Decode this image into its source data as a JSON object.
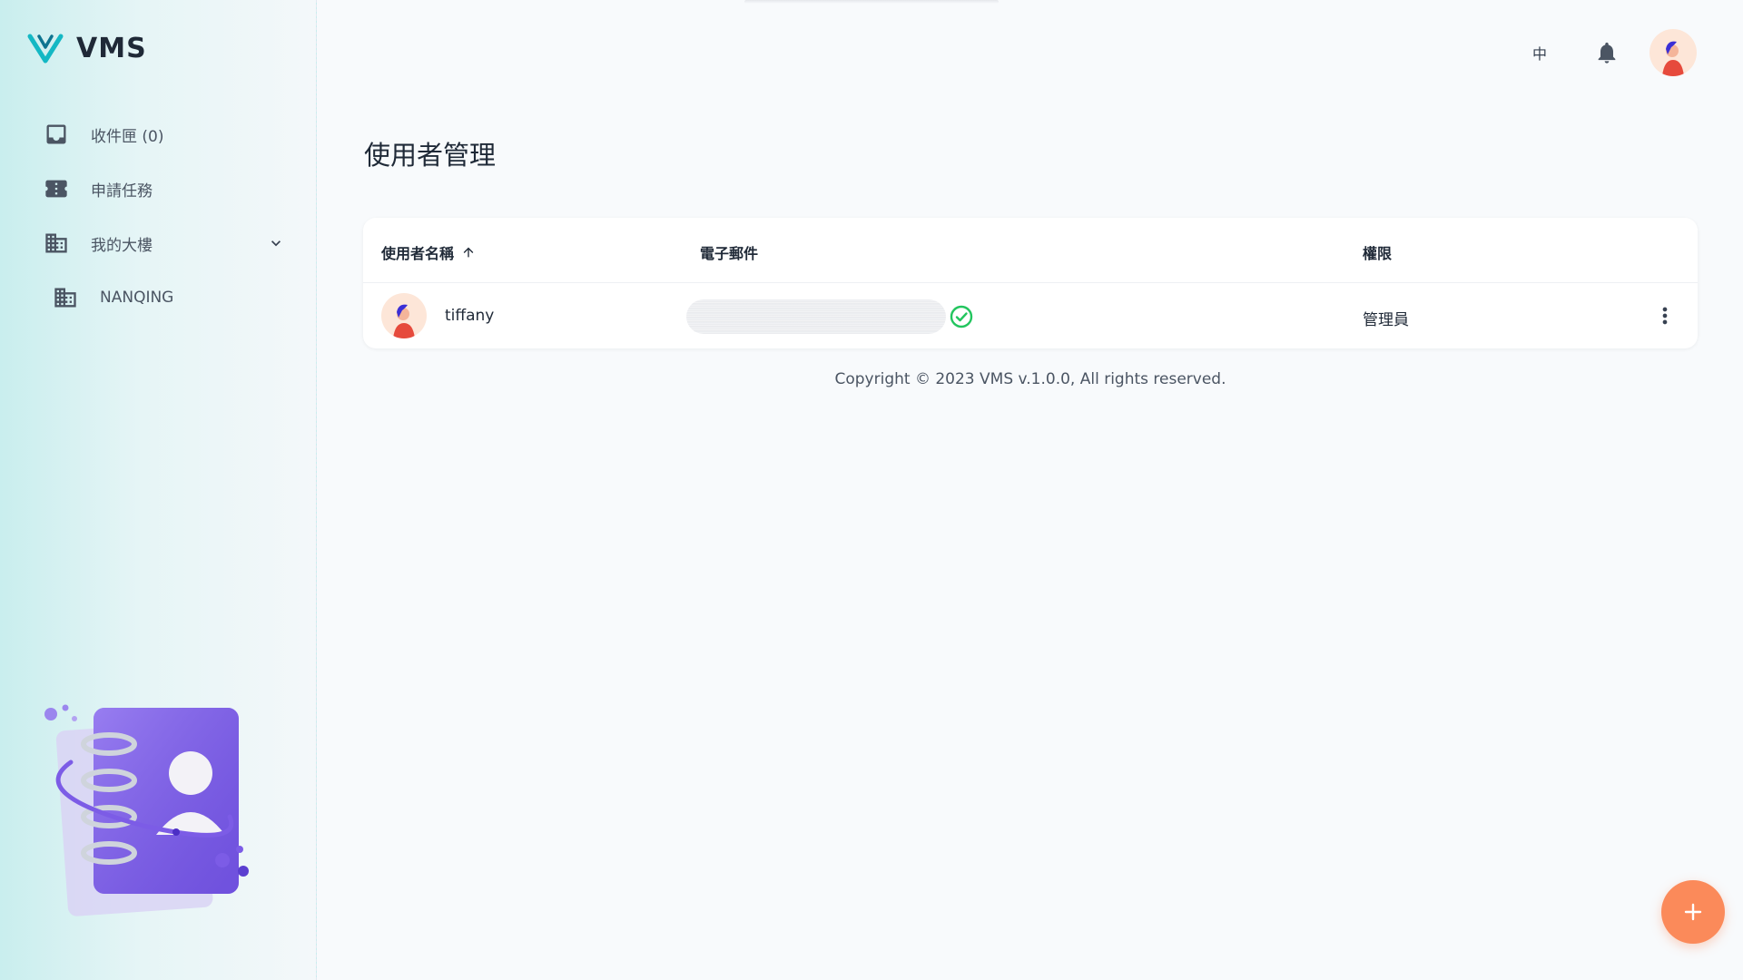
{
  "brand": {
    "name": "VMS"
  },
  "sidebar": {
    "items": [
      {
        "label": "收件匣 (0)",
        "icon": "inbox-icon"
      },
      {
        "label": "申請任務",
        "icon": "ticket-icon"
      },
      {
        "label": "我的大樓",
        "icon": "building-icon"
      },
      {
        "label": "NANQING",
        "icon": "building-icon"
      }
    ]
  },
  "header": {
    "language": "中",
    "icons": [
      "bell-icon",
      "avatar"
    ]
  },
  "page": {
    "title": "使用者管理"
  },
  "table": {
    "columns": [
      "使用者名稱",
      "電子郵件",
      "權限"
    ],
    "sort_icon": "arrow-up-icon",
    "rows": [
      {
        "username": "tiffany",
        "email_verified_icon": "check-circle-icon",
        "role": "管理員"
      }
    ]
  },
  "footer": {
    "copyright": "Copyright © 2023 VMS v.1.0.0, All rights reserved."
  },
  "colors": {
    "accent": "#fb8a5a",
    "brand_teal": "#14b8c4",
    "verified_green": "#22c55e",
    "illustration_purple": "#7c5ce6"
  }
}
